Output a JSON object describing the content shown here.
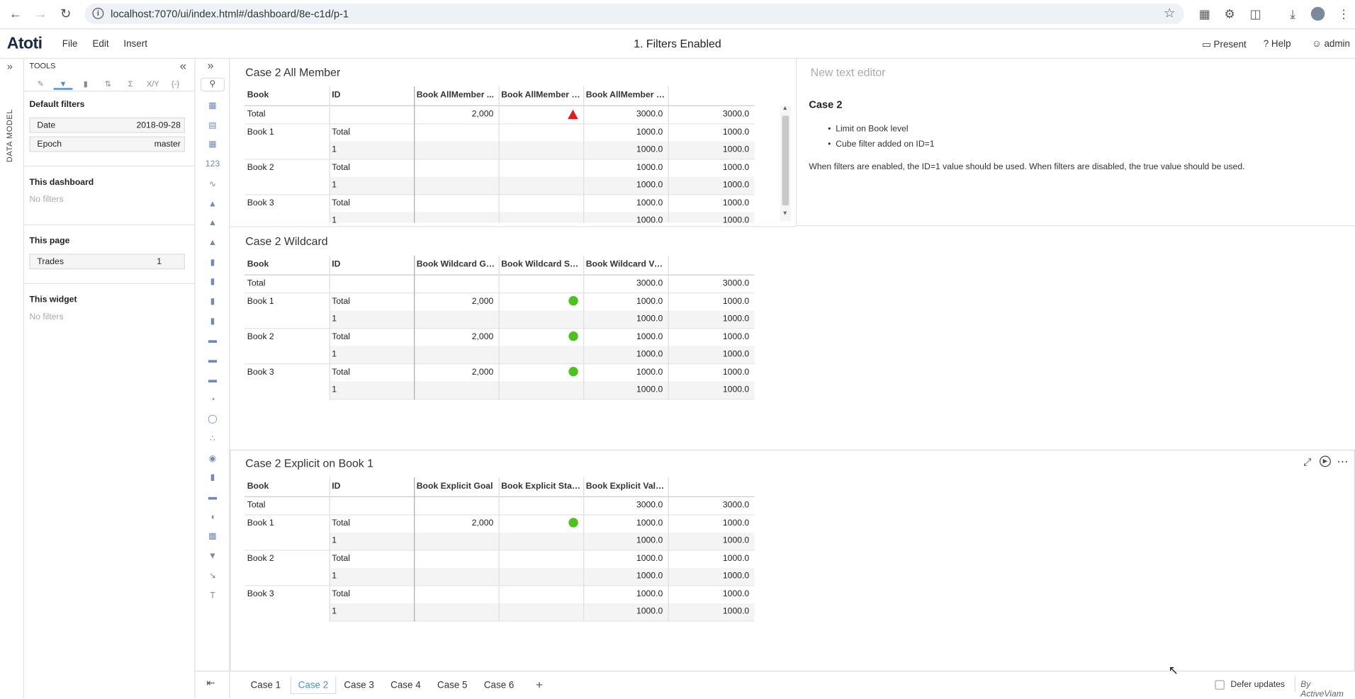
{
  "browser": {
    "url": "localhost:7070/ui/index.html#/dashboard/8e-c1d/p-1"
  },
  "app": {
    "logo": "Atoti",
    "menu": [
      "File",
      "Edit",
      "Insert"
    ],
    "title": "1. Filters Enabled",
    "present": "Present",
    "help": "Help",
    "user": "admin"
  },
  "rail": {
    "label": "DATA MODEL"
  },
  "tools": {
    "header": "TOOLS",
    "default_filters": "Default filters",
    "filters": [
      {
        "key": "Date",
        "value": "2018-09-28"
      },
      {
        "key": "Epoch",
        "value": "master"
      }
    ],
    "this_dashboard": "This dashboard",
    "this_dashboard_none": "No filters",
    "this_page": "This page",
    "page_filter": {
      "key": "Trades",
      "value": "1"
    },
    "this_widget": "This widget",
    "this_widget_none": "No filters"
  },
  "widgets": [
    {
      "title": "Case 2 All Member",
      "headers": [
        "Book",
        "ID",
        "Book AllMember ...",
        "Book AllMember S...",
        "Book AllMember V...",
        ""
      ],
      "rows": [
        {
          "book": "Total",
          "id": "",
          "goal": "2,000",
          "status": "triangle",
          "v1": "3000.0",
          "v2": "3000.0"
        },
        {
          "book": "Book 1",
          "id": "Total",
          "goal": "",
          "status": "",
          "v1": "1000.0",
          "v2": "1000.0"
        },
        {
          "book": "",
          "id": "1",
          "goal": "",
          "status": "",
          "v1": "1000.0",
          "v2": "1000.0"
        },
        {
          "book": "Book 2",
          "id": "Total",
          "goal": "",
          "status": "",
          "v1": "1000.0",
          "v2": "1000.0"
        },
        {
          "book": "",
          "id": "1",
          "goal": "",
          "status": "",
          "v1": "1000.0",
          "v2": "1000.0"
        },
        {
          "book": "Book 3",
          "id": "Total",
          "goal": "",
          "status": "",
          "v1": "1000.0",
          "v2": "1000.0"
        },
        {
          "book": "",
          "id": "1",
          "goal": "",
          "status": "",
          "v1": "1000.0",
          "v2": "1000.0"
        }
      ]
    },
    {
      "title": "Case 2 Wildcard",
      "headers": [
        "Book",
        "ID",
        "Book Wildcard Goal",
        "Book Wildcard Sta...",
        "Book Wildcard Val...",
        ""
      ],
      "rows": [
        {
          "book": "Total",
          "id": "",
          "goal": "",
          "status": "",
          "v1": "3000.0",
          "v2": "3000.0"
        },
        {
          "book": "Book 1",
          "id": "Total",
          "goal": "2,000",
          "status": "dot",
          "v1": "1000.0",
          "v2": "1000.0"
        },
        {
          "book": "",
          "id": "1",
          "goal": "",
          "status": "",
          "v1": "1000.0",
          "v2": "1000.0"
        },
        {
          "book": "Book 2",
          "id": "Total",
          "goal": "2,000",
          "status": "dot",
          "v1": "1000.0",
          "v2": "1000.0"
        },
        {
          "book": "",
          "id": "1",
          "goal": "",
          "status": "",
          "v1": "1000.0",
          "v2": "1000.0"
        },
        {
          "book": "Book 3",
          "id": "Total",
          "goal": "2,000",
          "status": "dot",
          "v1": "1000.0",
          "v2": "1000.0"
        },
        {
          "book": "",
          "id": "1",
          "goal": "",
          "status": "",
          "v1": "1000.0",
          "v2": "1000.0"
        }
      ]
    },
    {
      "title": "Case 2 Explicit on Book 1",
      "headers": [
        "Book",
        "ID",
        "Book Explicit Goal",
        "Book Explicit Status",
        "Book Explicit Value",
        ""
      ],
      "rows": [
        {
          "book": "Total",
          "id": "",
          "goal": "",
          "status": "",
          "v1": "3000.0",
          "v2": "3000.0"
        },
        {
          "book": "Book 1",
          "id": "Total",
          "goal": "2,000",
          "status": "dot",
          "v1": "1000.0",
          "v2": "1000.0"
        },
        {
          "book": "",
          "id": "1",
          "goal": "",
          "status": "",
          "v1": "1000.0",
          "v2": "1000.0"
        },
        {
          "book": "Book 2",
          "id": "Total",
          "goal": "",
          "status": "",
          "v1": "1000.0",
          "v2": "1000.0"
        },
        {
          "book": "",
          "id": "1",
          "goal": "",
          "status": "",
          "v1": "1000.0",
          "v2": "1000.0"
        },
        {
          "book": "Book 3",
          "id": "Total",
          "goal": "",
          "status": "",
          "v1": "1000.0",
          "v2": "1000.0"
        },
        {
          "book": "",
          "id": "1",
          "goal": "",
          "status": "",
          "v1": "1000.0",
          "v2": "1000.0"
        }
      ]
    }
  ],
  "text_editor": {
    "placeholder": "New text editor",
    "heading": "Case 2",
    "bullets": [
      "Limit on Book level",
      "Cube filter added on ID=1"
    ],
    "paragraph": "When filters are enabled, the ID=1 value should be used. When filters are disabled, the true value should be used."
  },
  "colors": {
    "status_ok": "#4cc21e",
    "status_bad": "#e01b1b",
    "accent": "#4a90d9"
  },
  "page_tabs": [
    "Case 1",
    "Case 2",
    "Case 3",
    "Case 4",
    "Case 5",
    "Case 6"
  ],
  "active_tab": "Case 2",
  "footer": {
    "defer": "Defer updates",
    "brand": "By ActiveViam"
  }
}
